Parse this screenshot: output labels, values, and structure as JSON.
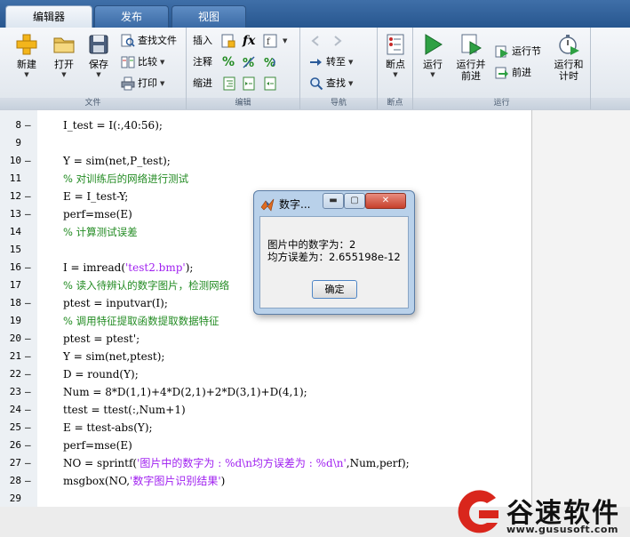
{
  "tabs": [
    {
      "label": "编辑器",
      "active": true
    },
    {
      "label": "发布",
      "active": false
    },
    {
      "label": "视图",
      "active": false
    }
  ],
  "ribbon": {
    "file": {
      "group_label": "文件",
      "new_label": "新建",
      "open_label": "打开",
      "save_label": "保存",
      "find_file_label": "查找文件",
      "compare_label": "比较",
      "print_label": "打印"
    },
    "edit": {
      "group_label": "编辑",
      "insert_label": "插入",
      "comment_label": "注释",
      "indent_label": "缩进",
      "fx_label": "fx"
    },
    "navigate": {
      "group_label": "导航",
      "goto_label": "转至",
      "find_label": "查找"
    },
    "breakpoints": {
      "group_label": "断点",
      "breakpoint_label": "断点"
    },
    "run": {
      "group_label": "运行",
      "run_label": "运行",
      "run_advance_label_1": "运行并",
      "run_advance_label_2": "前进",
      "run_section_label": "运行节",
      "advance_label": "前进",
      "run_time_label_1": "运行和",
      "run_time_label_2": "计时"
    }
  },
  "code_lines": [
    {
      "n": "8",
      "dash": "–",
      "text": "I_test = I(:,40:56);",
      "kind": "code"
    },
    {
      "n": "9",
      "dash": "",
      "text": "",
      "kind": "code"
    },
    {
      "n": "10",
      "dash": "–",
      "text": "Y = sim(net,P_test);",
      "kind": "code"
    },
    {
      "n": "11",
      "dash": "",
      "text": "% 对训练后的网络进行测试",
      "kind": "comment"
    },
    {
      "n": "12",
      "dash": "–",
      "text": "E = I_test-Y;",
      "kind": "code"
    },
    {
      "n": "13",
      "dash": "–",
      "text": "perf=mse(E)",
      "kind": "code"
    },
    {
      "n": "14",
      "dash": "",
      "text": "% 计算测试误差",
      "kind": "comment"
    },
    {
      "n": "15",
      "dash": "",
      "text": "",
      "kind": "code"
    },
    {
      "n": "16",
      "dash": "–",
      "text": "I = imread('test2.bmp');",
      "kind": "code"
    },
    {
      "n": "17",
      "dash": "",
      "text": "% 读入待辨认的数字图片，检测网络",
      "kind": "comment"
    },
    {
      "n": "18",
      "dash": "–",
      "text": "ptest = inputvar(I);",
      "kind": "code"
    },
    {
      "n": "19",
      "dash": "",
      "text": "% 调用特征提取函数提取数据特征",
      "kind": "comment"
    },
    {
      "n": "20",
      "dash": "–",
      "text": "ptest = ptest';",
      "kind": "code"
    },
    {
      "n": "21",
      "dash": "–",
      "text": "Y = sim(net,ptest);",
      "kind": "code"
    },
    {
      "n": "22",
      "dash": "–",
      "text": "D = round(Y);",
      "kind": "code"
    },
    {
      "n": "23",
      "dash": "–",
      "text": "Num = 8*D(1,1)+4*D(2,1)+2*D(3,1)+D(4,1);",
      "kind": "code"
    },
    {
      "n": "24",
      "dash": "–",
      "text": "ttest = ttest(:,Num+1)",
      "kind": "code"
    },
    {
      "n": "25",
      "dash": "–",
      "text": "E = ttest-abs(Y);",
      "kind": "code"
    },
    {
      "n": "26",
      "dash": "–",
      "text": "perf=mse(E)",
      "kind": "code"
    },
    {
      "n": "27",
      "dash": "–",
      "text": "NO = sprintf('图片中的数字为 : %d\\n均方误差为 : %d\\n',Num,perf);",
      "kind": "code"
    },
    {
      "n": "28",
      "dash": "–",
      "text": "msgbox(NO,'数字图片识别结果')",
      "kind": "code"
    },
    {
      "n": "29",
      "dash": "",
      "text": "",
      "kind": "code"
    }
  ],
  "dialog": {
    "title": "数字...",
    "line1": "图片中的数字为：2",
    "line2": "均方误差为：2.655198e-12",
    "ok_label": "确定"
  },
  "watermark": {
    "brand": "谷速软件",
    "url": "www.gususoft.com"
  },
  "colors": {
    "tabbar": "#2f609b",
    "comment": "#228b22",
    "string": "#a020f0",
    "run_green": "#2ea043",
    "watermark_red": "#d9261c"
  }
}
